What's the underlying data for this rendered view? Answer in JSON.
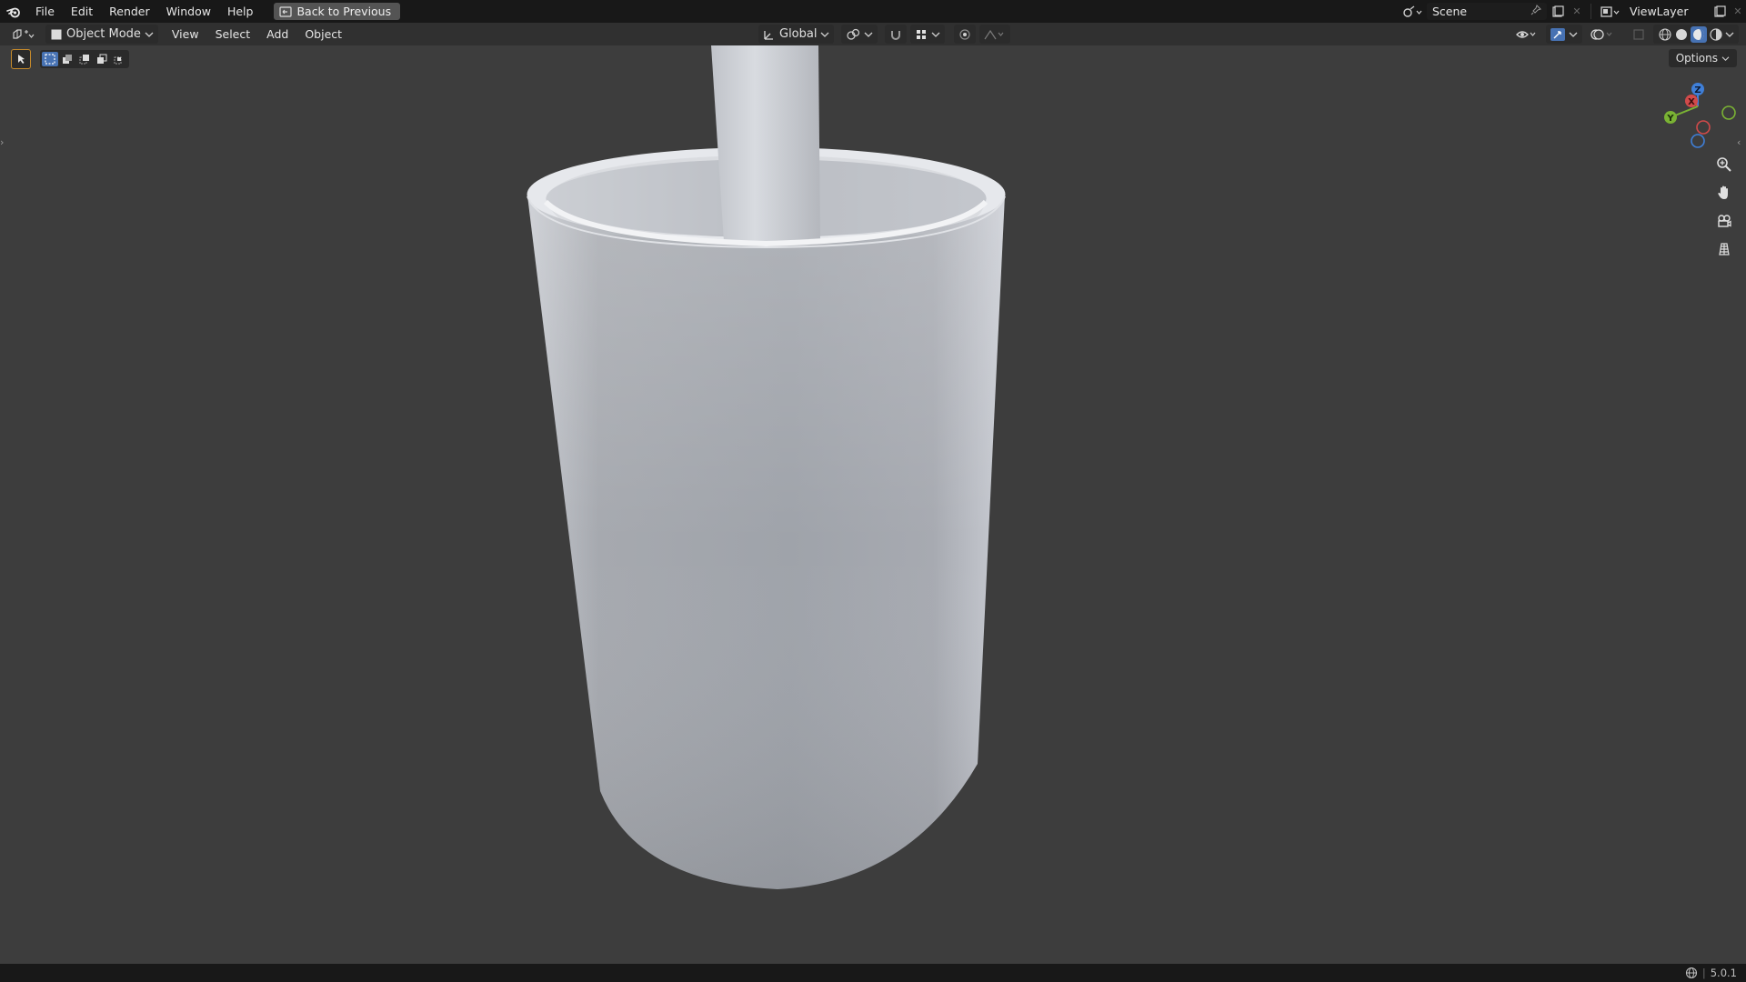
{
  "topbar": {
    "menus": [
      "File",
      "Edit",
      "Render",
      "Window",
      "Help"
    ],
    "back_button": "Back to Previous",
    "scene_name": "Scene",
    "view_layer": "ViewLayer"
  },
  "header": {
    "mode": "Object Mode",
    "menus": [
      "View",
      "Select",
      "Add",
      "Object"
    ],
    "transform_orientation": "Global"
  },
  "viewport": {
    "options_label": "Options",
    "gizmo_axes": [
      "Z",
      "X",
      "Y"
    ],
    "axis_colors": {
      "x": "#d14a4a",
      "y": "#7ab234",
      "z": "#3f7fd8"
    },
    "object": "white cup / glass with a tall cylinder inside",
    "background_color": "#3d3d3d"
  },
  "statusbar": {
    "version": "5.0.1"
  },
  "icons": [
    "blender-logo-icon",
    "editor-type-icon",
    "object-mode-icon",
    "select-box-icon",
    "gizmo-icon",
    "zoom-icon",
    "hand-pan-icon",
    "camera-icon",
    "grid-ortho-icon"
  ]
}
